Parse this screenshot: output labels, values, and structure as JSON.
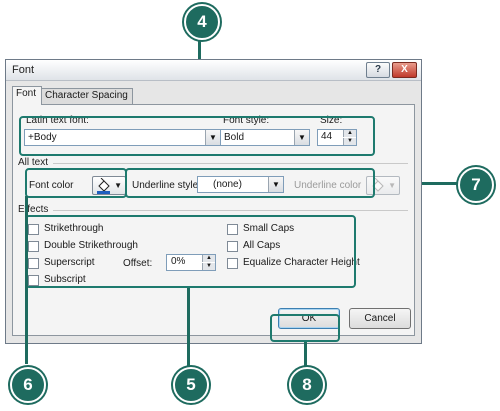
{
  "dialog": {
    "title": "Font",
    "help_button": "?",
    "close_button": "X",
    "tabs": [
      {
        "label": "Font",
        "active": true
      },
      {
        "label": "Character Spacing",
        "active": false
      }
    ]
  },
  "font_tab": {
    "latin_label": "Latin text font:",
    "latin_value": "+Body",
    "style_label": "Font style:",
    "style_value": "Bold",
    "size_label": "Size:",
    "size_value": "44",
    "all_text_heading": "All text",
    "font_color_label": "Font color",
    "underline_style_label": "Underline style",
    "underline_style_value": "(none)",
    "underline_color_label": "Underline color",
    "effects_heading": "Effects",
    "effects": {
      "strikethrough": {
        "label": "Strikethrough",
        "checked": false
      },
      "double_strikethrough": {
        "label": "Double Strikethrough",
        "checked": false
      },
      "superscript": {
        "label": "Superscript",
        "checked": false
      },
      "subscript": {
        "label": "Subscript",
        "checked": false
      },
      "small_caps": {
        "label": "Small Caps",
        "checked": false
      },
      "all_caps": {
        "label": "All Caps",
        "checked": false
      },
      "equalize_height": {
        "label": "Equalize Character Height",
        "checked": false
      }
    },
    "offset_label": "Offset:",
    "offset_value": "0%",
    "ok_button": "OK",
    "cancel_button": "Cancel"
  },
  "callouts": [
    "4",
    "7",
    "6",
    "5",
    "8"
  ],
  "colors": {
    "callout": "#1e6b5f",
    "highlight": "#1e7a6e",
    "dialog_bg": "#f4f4f4"
  }
}
